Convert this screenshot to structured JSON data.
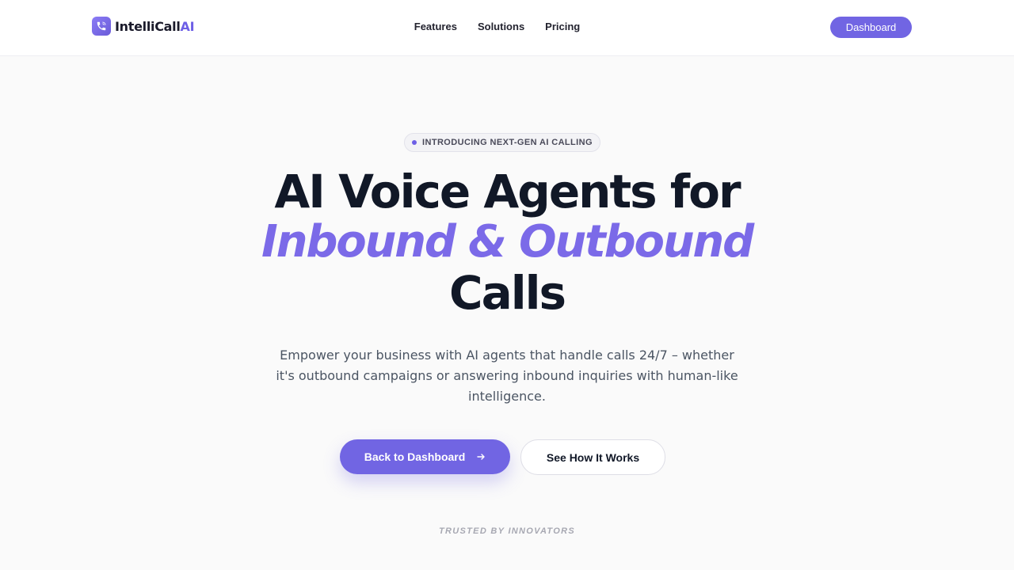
{
  "brand": {
    "name_main": "IntelliCall",
    "name_accent": "AI",
    "logo_icon": "phone-icon"
  },
  "nav": {
    "items": [
      {
        "label": "Features"
      },
      {
        "label": "Solutions"
      },
      {
        "label": "Pricing"
      }
    ],
    "dashboard_label": "Dashboard"
  },
  "hero": {
    "badge": "INTRODUCING NEXT-GEN AI CALLING",
    "headline_line1": "AI Voice Agents for",
    "headline_accent": "Inbound & Outbound",
    "headline_line3": "Calls",
    "subtitle": "Empower your business with AI agents that handle calls 24/7 – whether it's outbound campaigns or answering inbound inquiries with human-like intelligence.",
    "primary_cta": "Back to Dashboard",
    "primary_cta_icon": "arrow-right-icon",
    "secondary_cta": "See How It Works",
    "trusted_label": "TRUSTED BY INNOVATORS"
  },
  "colors": {
    "accent": "#7165e3",
    "headline_accent": "#7b6ae8",
    "text_dark": "#111827",
    "text_muted": "#4b5563"
  }
}
